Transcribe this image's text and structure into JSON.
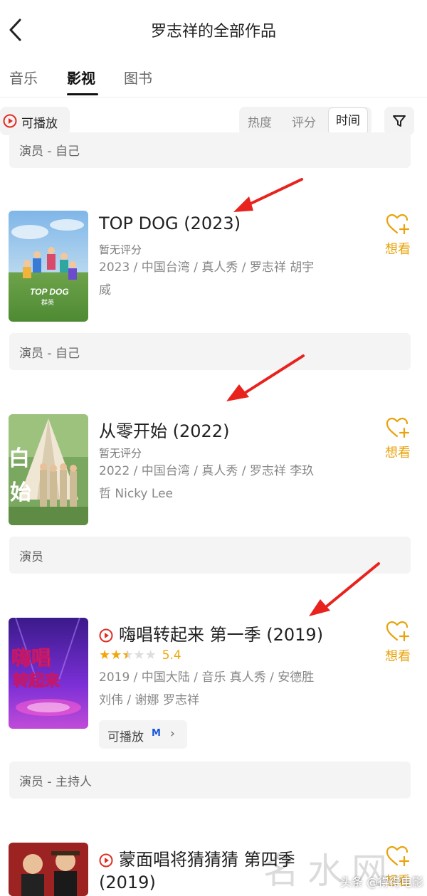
{
  "header": {
    "title": "罗志祥的全部作品"
  },
  "tabs": [
    {
      "label": "音乐"
    },
    {
      "label": "影视"
    },
    {
      "label": "图书"
    }
  ],
  "filters": {
    "playable_label": "可播放",
    "sort_options": [
      {
        "label": "热度"
      },
      {
        "label": "评分"
      },
      {
        "label": "时间"
      }
    ],
    "active_sort": "时间"
  },
  "roles": [
    "演员 - 自己",
    "演员 - 自己",
    "演员",
    "演员 - 主持人"
  ],
  "works": [
    {
      "title": "TOP DOG (2023)",
      "rating_text": "暂无评分",
      "meta_line1": "2023 / 中国台湾 / 真人秀 / 罗志祥 胡宇",
      "meta_line2": "威",
      "want_label": "想看",
      "poster_text": "TOP DOG",
      "poster_sub": "群英"
    },
    {
      "title": "从零开始 (2022)",
      "rating_text": "暂无评分",
      "meta_line1": "2022 / 中国台湾 / 真人秀 / 罗志祥 李玖",
      "meta_line2": "哲 Nicky Lee",
      "want_label": "想看",
      "poster_text": "白",
      "poster_sub": "始"
    },
    {
      "title": "嗨唱转起来 第一季 (2019)",
      "rating": "5.4",
      "stars": 2.5,
      "meta_line1": "2019 / 中国大陆 / 音乐 真人秀 / 安德胜",
      "meta_line2": "刘伟 / 谢娜 罗志祥",
      "want_label": "想看",
      "play_label": "可播放",
      "play_logo": "M",
      "chevron": "›",
      "poster_text": "嗨唱",
      "poster_sub": "转起来"
    },
    {
      "title_line1": "蒙面唱将猜猜猜 第四季",
      "title_line2": "(2019)",
      "want_label": "想看"
    }
  ],
  "watermark": {
    "big": "名水网",
    "small": "头条 @得得电影"
  },
  "colors": {
    "accent": "#e8a30c",
    "play_red": "#e02e24",
    "arrow_red": "#e8231d"
  }
}
